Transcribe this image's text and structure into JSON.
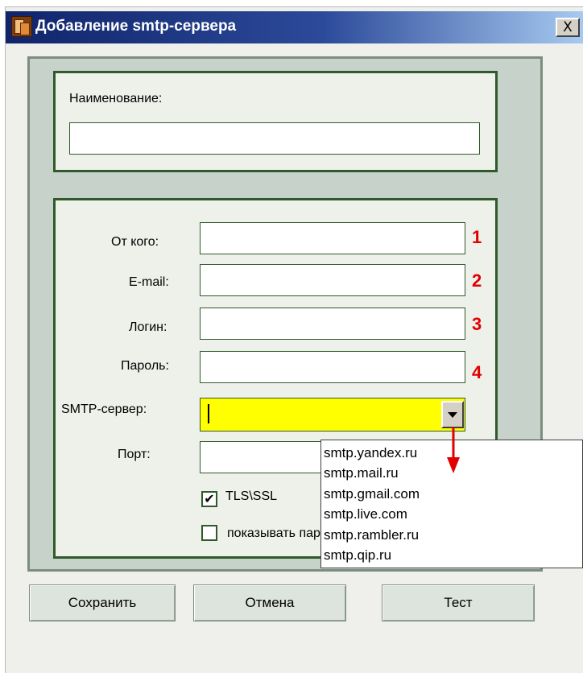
{
  "window": {
    "title": "Добавление smtp-сервера",
    "close_label": "X"
  },
  "name_group": {
    "label": "Наименование:",
    "value": ""
  },
  "fields": [
    {
      "label": "От кого:",
      "value": "",
      "number": "1"
    },
    {
      "label": "E-mail:",
      "value": "",
      "number": "2"
    },
    {
      "label": "Логин:",
      "value": "",
      "number": "3"
    },
    {
      "label": "Пароль:",
      "value": "",
      "number": "4"
    }
  ],
  "smtp": {
    "label": "SMTP-сервер:",
    "value": "",
    "options": [
      "smtp.yandex.ru",
      "smtp.mail.ru",
      "smtp.gmail.com",
      "smtp.live.com",
      "smtp.rambler.ru",
      "smtp.qip.ru"
    ]
  },
  "port": {
    "label": "Порт:",
    "value": ""
  },
  "tls": {
    "label": "TLS\\SSL",
    "checked": true,
    "check_glyph": "✔"
  },
  "show_password": {
    "label": "показывать пароль",
    "checked": false
  },
  "buttons": {
    "save": "Сохранить",
    "cancel": "Отмена",
    "test": "Тест"
  },
  "colors": {
    "accent_green": "#2f5a2a",
    "highlight_yellow": "#ffff00",
    "number_red": "#e00000",
    "title_blue": "#10246a"
  }
}
